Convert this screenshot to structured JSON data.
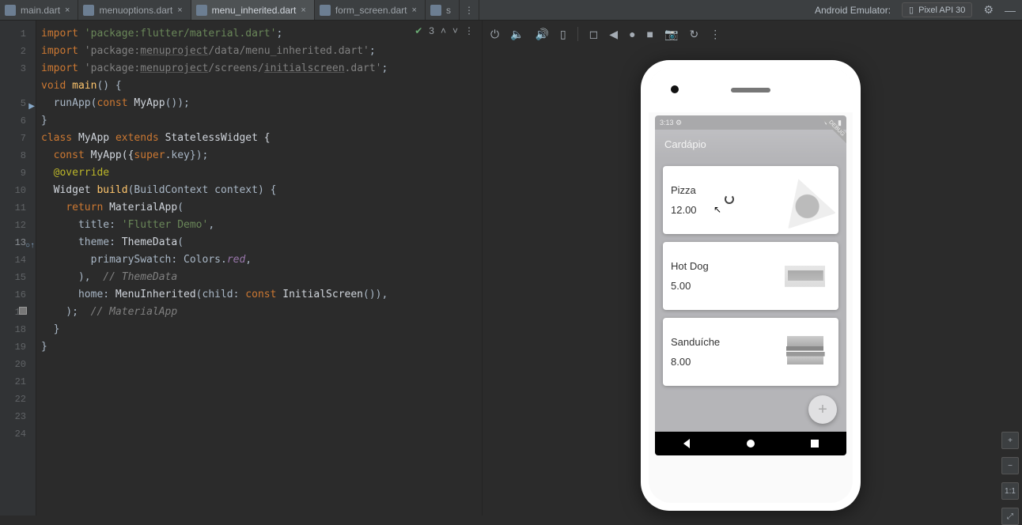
{
  "tabs": [
    {
      "label": "main.dart",
      "active": false
    },
    {
      "label": "menuoptions.dart",
      "active": false
    },
    {
      "label": "menu_inherited.dart",
      "active": true
    },
    {
      "label": "form_screen.dart",
      "active": false
    },
    {
      "label": "s",
      "active": false
    }
  ],
  "topbar": {
    "emulator_label": "Android Emulator:",
    "device_icon": "phone-icon",
    "device_label": "Pixel API 30"
  },
  "editor_indicator": {
    "count": "3"
  },
  "editor_toolbar_icons": [
    "chevron-down",
    "chevron-up",
    "more"
  ],
  "gutter": {
    "lines": [
      "1",
      "2",
      "3",
      "",
      "5",
      "6",
      "7",
      "8",
      "9",
      "10",
      "11",
      "12",
      "13",
      "14",
      "15",
      "16",
      "17",
      "18",
      "19",
      "20",
      "21",
      "22",
      "23",
      "24"
    ]
  },
  "code": {
    "lines": [
      {
        "seg": [
          {
            "t": "import ",
            "c": "kw"
          },
          {
            "t": "'package:flutter/material.dart'",
            "c": "str"
          },
          {
            "t": ";",
            "c": ""
          }
        ]
      },
      {
        "seg": [
          {
            "t": "import ",
            "c": "kw"
          },
          {
            "t": "'package:",
            "c": "str-dim"
          },
          {
            "t": "menuproject",
            "c": "str-dim und"
          },
          {
            "t": "/data/menu_inherited.dart'",
            "c": "str-dim"
          },
          {
            "t": ";",
            "c": ""
          }
        ]
      },
      {
        "seg": [
          {
            "t": "import ",
            "c": "kw"
          },
          {
            "t": "'package:",
            "c": "str-dim"
          },
          {
            "t": "menuproject",
            "c": "str-dim und"
          },
          {
            "t": "/screens/",
            "c": "str-dim"
          },
          {
            "t": "initialscreen",
            "c": "str-dim und"
          },
          {
            "t": ".dart'",
            "c": "str-dim"
          },
          {
            "t": ";",
            "c": ""
          }
        ]
      },
      {
        "seg": [
          {
            "t": "",
            "c": ""
          }
        ]
      },
      {
        "seg": [
          {
            "t": "void ",
            "c": "kw"
          },
          {
            "t": "main",
            "c": "mtd"
          },
          {
            "t": "() {",
            "c": ""
          }
        ]
      },
      {
        "seg": [
          {
            "t": "  runApp(",
            "c": ""
          },
          {
            "t": "const ",
            "c": "kw"
          },
          {
            "t": "MyApp",
            "c": "typ"
          },
          {
            "t": "());",
            "c": ""
          }
        ]
      },
      {
        "seg": [
          {
            "t": "}",
            "c": ""
          }
        ]
      },
      {
        "seg": [
          {
            "t": "",
            "c": ""
          }
        ]
      },
      {
        "seg": [
          {
            "t": "class ",
            "c": "kw"
          },
          {
            "t": "MyApp ",
            "c": "typ"
          },
          {
            "t": "extends ",
            "c": "kw"
          },
          {
            "t": "StatelessWidget {",
            "c": "typ"
          }
        ]
      },
      {
        "seg": [
          {
            "t": "  ",
            "c": ""
          },
          {
            "t": "const ",
            "c": "kw"
          },
          {
            "t": "MyApp({",
            "c": "typ"
          },
          {
            "t": "super",
            "c": "kw"
          },
          {
            "t": ".key});",
            "c": ""
          }
        ]
      },
      {
        "seg": [
          {
            "t": "",
            "c": ""
          }
        ]
      },
      {
        "seg": [
          {
            "t": "  ",
            "c": ""
          },
          {
            "t": "@override",
            "c": "ann"
          }
        ]
      },
      {
        "seg": [
          {
            "t": "  Widget ",
            "c": "typ"
          },
          {
            "t": "build",
            "c": "mtd"
          },
          {
            "t": "(BuildContext context) {",
            "c": ""
          }
        ]
      },
      {
        "seg": [
          {
            "t": "    ",
            "c": ""
          },
          {
            "t": "return ",
            "c": "kw"
          },
          {
            "t": "MaterialApp",
            "c": "typ"
          },
          {
            "t": "(",
            "c": ""
          }
        ]
      },
      {
        "seg": [
          {
            "t": "      title: ",
            "c": ""
          },
          {
            "t": "'Flutter Demo'",
            "c": "str"
          },
          {
            "t": ",",
            "c": ""
          }
        ]
      },
      {
        "seg": [
          {
            "t": "      theme: ",
            "c": ""
          },
          {
            "t": "ThemeData",
            "c": "typ"
          },
          {
            "t": "(",
            "c": ""
          }
        ]
      },
      {
        "seg": [
          {
            "t": "        primarySwatch: Colors.",
            "c": ""
          },
          {
            "t": "red",
            "c": "prop ital"
          },
          {
            "t": ",",
            "c": ""
          }
        ]
      },
      {
        "seg": [
          {
            "t": "      ),  ",
            "c": ""
          },
          {
            "t": "// ThemeData",
            "c": "cmt"
          }
        ]
      },
      {
        "seg": [
          {
            "t": "      home: ",
            "c": ""
          },
          {
            "t": "MenuInherited",
            "c": "typ"
          },
          {
            "t": "(child: ",
            "c": ""
          },
          {
            "t": "const ",
            "c": "kw"
          },
          {
            "t": "InitialScreen",
            "c": "typ"
          },
          {
            "t": "()),",
            "c": ""
          }
        ]
      },
      {
        "seg": [
          {
            "t": "    );  ",
            "c": ""
          },
          {
            "t": "// MaterialApp",
            "c": "cmt"
          }
        ]
      },
      {
        "seg": [
          {
            "t": "  }",
            "c": ""
          }
        ]
      },
      {
        "seg": [
          {
            "t": "}",
            "c": ""
          }
        ]
      },
      {
        "seg": [
          {
            "t": "",
            "c": ""
          }
        ]
      },
      {
        "seg": [
          {
            "t": "",
            "c": ""
          }
        ]
      }
    ]
  },
  "emulator_toolbar": {
    "icons": [
      "power",
      "volume",
      "volume-up",
      "phone",
      "",
      "capture",
      "back",
      "record",
      "stop",
      "camera",
      "rotate",
      "more"
    ]
  },
  "emulator_side": {
    "zoom_in": "+",
    "zoom_out": "−",
    "fit": "1:1",
    "reset": "⤢"
  },
  "phone": {
    "status_time": "3:13",
    "status_gear": "⚙",
    "appbar_title": "Cardápio",
    "debug_banner": "DEBUG",
    "fab_label": "+",
    "cards": [
      {
        "name": "Pizza",
        "price": "12.00",
        "thumb": "pizza"
      },
      {
        "name": "Hot Dog",
        "price": "5.00",
        "thumb": "hotdog"
      },
      {
        "name": "Sanduíche",
        "price": "8.00",
        "thumb": "burger"
      }
    ]
  }
}
